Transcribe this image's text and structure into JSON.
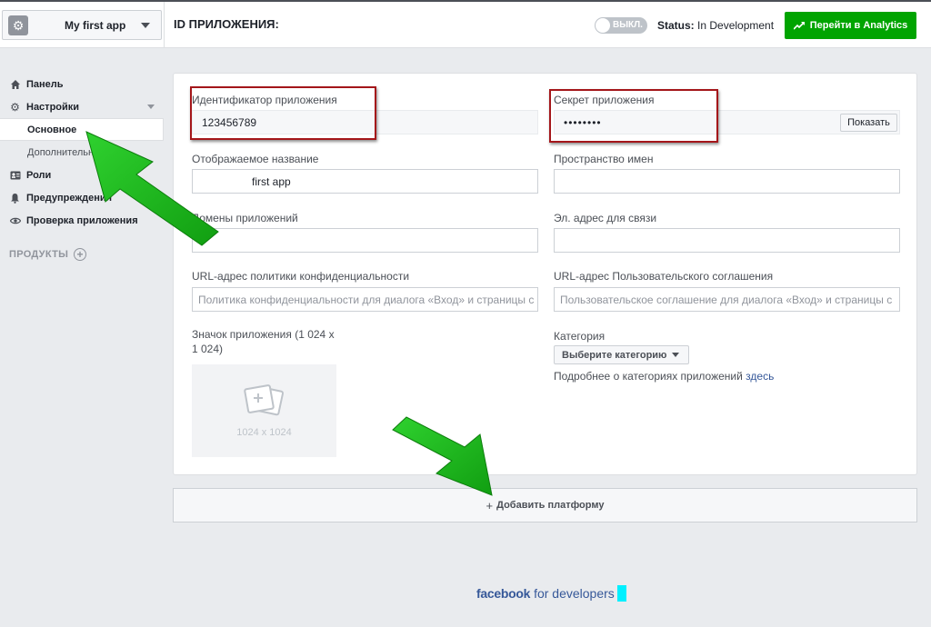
{
  "header": {
    "app_name": "My first app",
    "app_id_label": "ID ПРИЛОЖЕНИЯ:",
    "toggle_label": "ВЫКЛ.",
    "status_prefix": "Status:",
    "status_value": "In Development",
    "analytics_button": "Перейти в Analytics"
  },
  "sidebar": {
    "items": [
      {
        "label": "Панель",
        "icon": "home-icon"
      },
      {
        "label": "Настройки",
        "icon": "gear-icon"
      },
      {
        "label": "Основное"
      },
      {
        "label": "Дополнительно"
      },
      {
        "label": "Роли",
        "icon": "id-card-icon"
      },
      {
        "label": "Предупреждения",
        "icon": "bell-icon"
      },
      {
        "label": "Проверка приложения",
        "icon": "eye-icon"
      }
    ],
    "products_label": "ПРОДУКТЫ"
  },
  "form": {
    "app_id_label": "Идентификатор приложения",
    "app_id_value": "123456789",
    "secret_label": "Секрет приложения",
    "secret_value": "••••••••",
    "show_button": "Показать",
    "display_name_label": "Отображаемое название",
    "display_name_value": "first app",
    "namespace_label": "Пространство имен",
    "namespace_value": "",
    "domains_label": "Домены приложений",
    "domains_value": "",
    "email_label": "Эл. адрес для связи",
    "email_value": "",
    "privacy_label": "URL-адрес политики конфиденциальности",
    "privacy_placeholder": "Политика конфиденциальности для диалога «Вход» и страницы с",
    "terms_label": "URL-адрес Пользовательского соглашения",
    "terms_placeholder": "Пользовательское соглашение для диалога «Вход» и страницы с",
    "icon_label_1": "Значок приложения (1 024 x",
    "icon_label_2": "1 024)",
    "icon_size": "1024 x 1024",
    "category_label": "Категория",
    "category_button": "Выберите категорию",
    "category_more_prefix": "Подробнее о категориях приложений",
    "category_more_link": "здесь"
  },
  "add_platform": "Добавить платформу",
  "footer": {
    "brand": "facebook",
    "suffix": "for developers"
  },
  "colors": {
    "green_button": "#00a400",
    "link": "#365899",
    "annotation_red": "#a4161a",
    "annotation_arrow": "#17b117"
  }
}
